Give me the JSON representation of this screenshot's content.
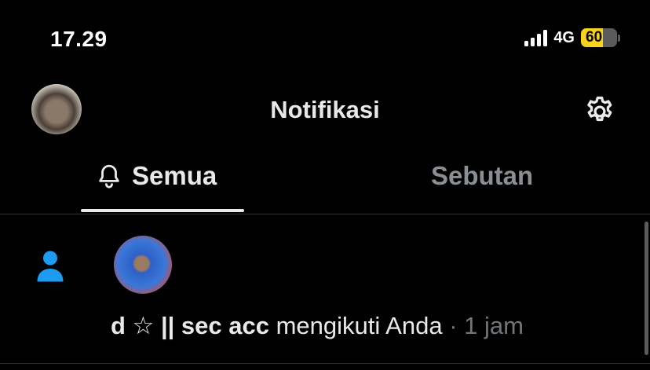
{
  "status_bar": {
    "time": "17.29",
    "network": "4G",
    "battery": "60",
    "battery_level": 0.6,
    "battery_color": "#f7d31d"
  },
  "header": {
    "title": "Notifikasi"
  },
  "tabs": [
    {
      "label": "Semua",
      "active": true,
      "icon": "bell-icon"
    },
    {
      "label": "Sebutan",
      "active": false
    }
  ],
  "notifications": [
    {
      "type": "follow",
      "icon": "person-icon",
      "icon_color": "#1d9bf0",
      "name": "d ☆ || sec acc",
      "action": "mengikuti Anda",
      "separator": "·",
      "time": "1 jam"
    }
  ]
}
